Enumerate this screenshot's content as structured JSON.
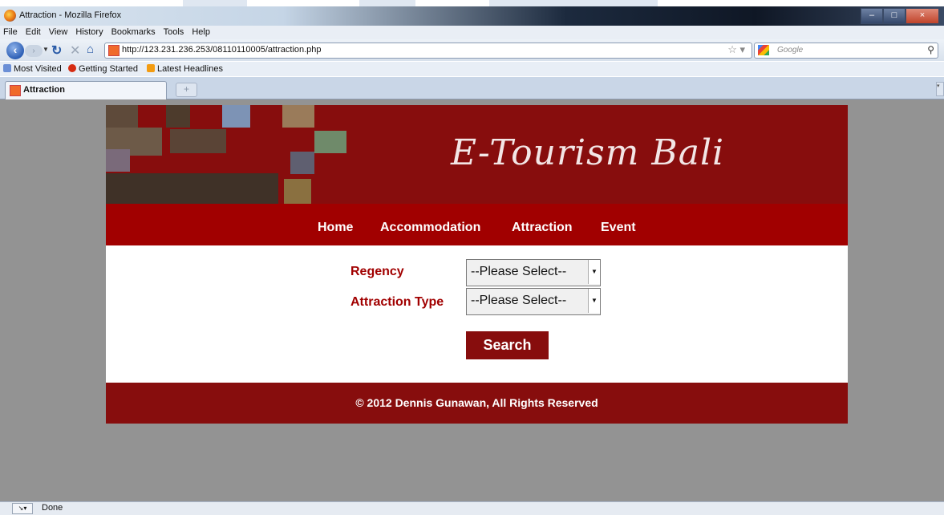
{
  "window": {
    "title": "Attraction - Mozilla Firefox",
    "controls": [
      "–",
      "□",
      "×"
    ]
  },
  "menu": [
    "File",
    "Edit",
    "View",
    "History",
    "Bookmarks",
    "Tools",
    "Help"
  ],
  "toolbar": {
    "url": "http://123.231.236.253/08110110005/attraction.php",
    "search_placeholder": "Google"
  },
  "bookmarks": [
    {
      "label": "Most Visited",
      "icon": "bookmark-star-icon",
      "color": "#6b8fd6"
    },
    {
      "label": "Getting Started",
      "icon": "firefox-icon",
      "color": "#d62b12"
    },
    {
      "label": "Latest Headlines",
      "icon": "rss-icon",
      "color": "#f39c12"
    }
  ],
  "tabs": [
    {
      "label": "Attraction",
      "active": true
    }
  ],
  "site": {
    "brand": "E-Tourism Bali",
    "nav": [
      "Home",
      "Accommodation",
      "Attraction",
      "Event"
    ],
    "form": {
      "regency_label": "Regency",
      "regency_value": "--Please Select--",
      "type_label": "Attraction Type",
      "type_value": "--Please Select--",
      "search_button": "Search"
    },
    "footer": "© 2012 Dennis Gunawan, All Rights Reserved"
  },
  "status": {
    "text": "Done"
  },
  "colors": {
    "banner": "#870d0d",
    "nav_strip": "#a10000",
    "label_red": "#a10000",
    "page_bg": "#939393"
  }
}
